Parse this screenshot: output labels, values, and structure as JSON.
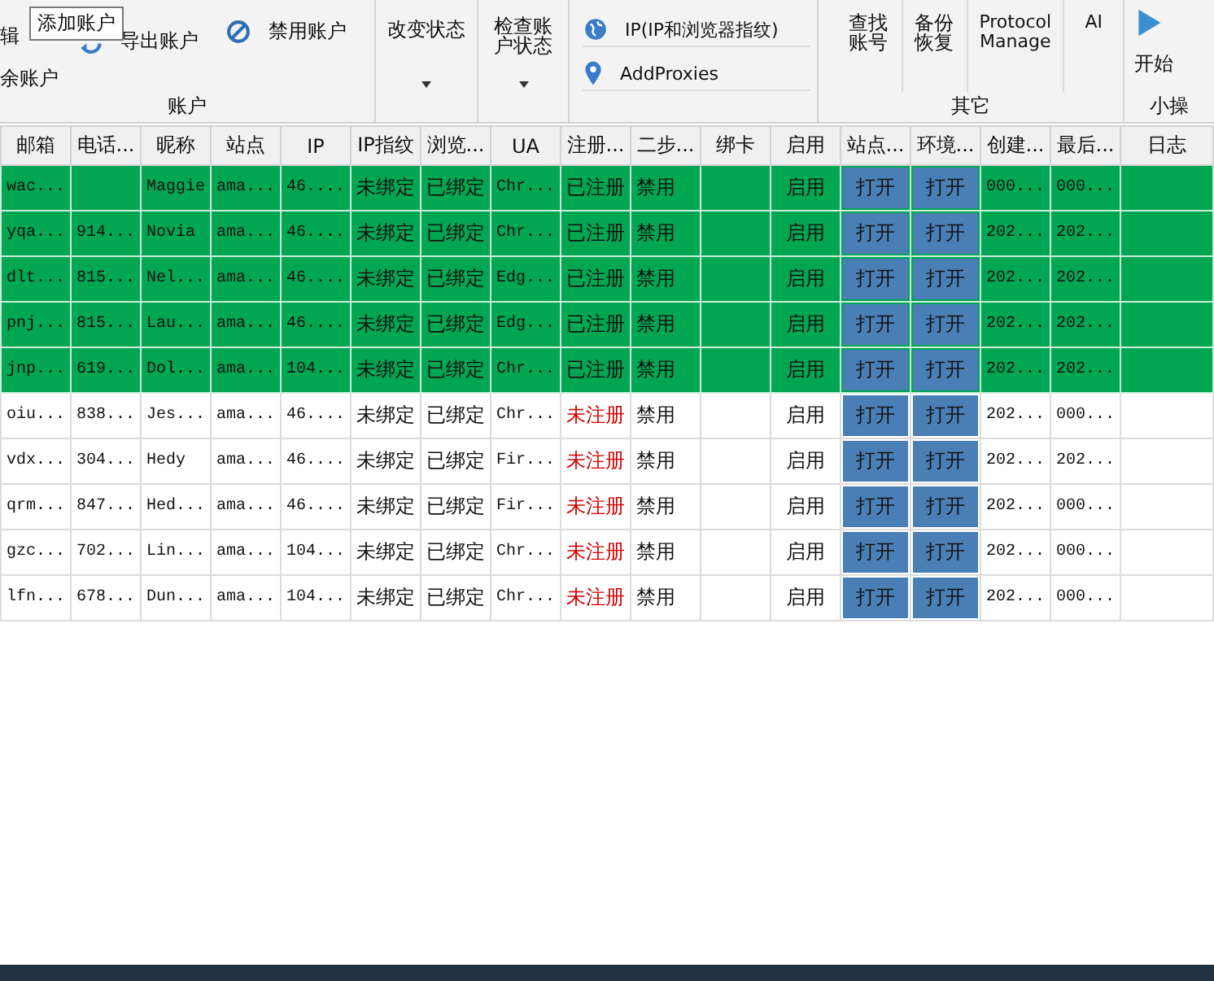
{
  "ribbon": {
    "groups": [
      {
        "label": "账户",
        "columns": [
          [
            {
              "text": "辑"
            },
            {
              "text": "余账户"
            }
          ],
          [
            {
              "text": "导出账户"
            }
          ],
          [
            {
              "text": "禁用账户"
            }
          ]
        ]
      },
      {
        "columns": [
          [
            {
              "text": "改变状态",
              "caret": true
            }
          ]
        ]
      },
      {
        "columns": [
          [
            {
              "text": "检查账户状态",
              "caret": true
            }
          ]
        ]
      },
      {
        "columns": [
          [
            {
              "text": "IP(IP和浏览器指纹)"
            },
            {
              "text": "AddProxies"
            }
          ]
        ]
      },
      {
        "label": "其它",
        "columns": [
          [
            {
              "text": "查找账号"
            }
          ],
          [
            {
              "text": "备份恢复"
            }
          ],
          [
            {
              "text": "Protocol Manage"
            }
          ],
          [
            {
              "text": "AI"
            }
          ]
        ]
      },
      {
        "label": "小操",
        "columns": [
          [
            {
              "text": "开始"
            }
          ]
        ]
      }
    ]
  },
  "tooltip": "添加账户",
  "table": {
    "columns": [
      {
        "label": "邮箱",
        "kind": "text"
      },
      {
        "label": "电话...",
        "kind": "text"
      },
      {
        "label": "昵称",
        "kind": "text"
      },
      {
        "label": "站点",
        "kind": "text"
      },
      {
        "label": "IP",
        "kind": "text"
      },
      {
        "label": "IP指纹",
        "kind": "text"
      },
      {
        "label": "浏览...",
        "kind": "text"
      },
      {
        "label": "UA",
        "kind": "text"
      },
      {
        "label": "注册...",
        "kind": "register"
      },
      {
        "label": "二步...",
        "kind": "text"
      },
      {
        "label": "绑卡",
        "kind": "text"
      },
      {
        "label": "启用",
        "kind": "center"
      },
      {
        "label": "站点...",
        "kind": "button"
      },
      {
        "label": "环境...",
        "kind": "button"
      },
      {
        "label": "创建...",
        "kind": "text"
      },
      {
        "label": "最后...",
        "kind": "text"
      },
      {
        "label": "日志",
        "kind": "text"
      }
    ],
    "rows": [
      {
        "highlighted": true,
        "registered": true,
        "cells": [
          "wac...",
          null,
          "Maggie",
          "ama...",
          "46....",
          "未绑定",
          "已绑定",
          "Chr...",
          "已注册",
          "禁用",
          null,
          "启用",
          "打开",
          "打开",
          "000...",
          "000...",
          null
        ]
      },
      {
        "highlighted": true,
        "registered": true,
        "cells": [
          "yqa...",
          "914...",
          "Novia",
          "ama...",
          "46....",
          "未绑定",
          "已绑定",
          "Chr...",
          "已注册",
          "禁用",
          null,
          "启用",
          "打开",
          "打开",
          "202...",
          "202...",
          null
        ]
      },
      {
        "highlighted": true,
        "registered": true,
        "cells": [
          "dlt...",
          "815...",
          "Nel...",
          "ama...",
          "46....",
          "未绑定",
          "已绑定",
          "Edg...",
          "已注册",
          "禁用",
          null,
          "启用",
          "打开",
          "打开",
          "202...",
          "202...",
          null
        ]
      },
      {
        "highlighted": true,
        "registered": true,
        "cells": [
          "pnj...",
          "815...",
          "Lau...",
          "ama...",
          "46....",
          "未绑定",
          "已绑定",
          "Edg...",
          "已注册",
          "禁用",
          null,
          "启用",
          "打开",
          "打开",
          "202...",
          "202...",
          null
        ]
      },
      {
        "highlighted": true,
        "registered": true,
        "cells": [
          "jnp...",
          "619...",
          "Dol...",
          "ama...",
          "104...",
          "未绑定",
          "已绑定",
          "Chr...",
          "已注册",
          "禁用",
          null,
          "启用",
          "打开",
          "打开",
          "202...",
          "202...",
          null
        ]
      },
      {
        "highlighted": false,
        "registered": false,
        "cells": [
          "oiu...",
          "838...",
          "Jes...",
          "ama...",
          "46....",
          "未绑定",
          "已绑定",
          "Chr...",
          "未注册",
          "禁用",
          null,
          "启用",
          "打开",
          "打开",
          "202...",
          "000...",
          null
        ]
      },
      {
        "highlighted": false,
        "registered": false,
        "cells": [
          "vdx...",
          "304...",
          "Hedy",
          "ama...",
          "46....",
          "未绑定",
          "已绑定",
          "Fir...",
          "未注册",
          "禁用",
          null,
          "启用",
          "打开",
          "打开",
          "202...",
          "202...",
          null
        ]
      },
      {
        "highlighted": false,
        "registered": false,
        "cells": [
          "qrm...",
          "847...",
          "Hed...",
          "ama...",
          "46....",
          "未绑定",
          "已绑定",
          "Fir...",
          "未注册",
          "禁用",
          null,
          "启用",
          "打开",
          "打开",
          "202...",
          "000...",
          null
        ]
      },
      {
        "highlighted": false,
        "registered": false,
        "cells": [
          "gzc...",
          "702...",
          "Lin...",
          "ama...",
          "104...",
          "未绑定",
          "已绑定",
          "Chr...",
          "未注册",
          "禁用",
          null,
          "启用",
          "打开",
          "打开",
          "202...",
          "000...",
          null
        ]
      },
      {
        "highlighted": false,
        "registered": false,
        "cells": [
          "lfn...",
          "678...",
          "Dun...",
          "ama...",
          "104...",
          "未绑定",
          "已绑定",
          "Chr...",
          "未注册",
          "禁用",
          null,
          "启用",
          "打开",
          "打开",
          "202...",
          "000...",
          null
        ]
      }
    ]
  }
}
